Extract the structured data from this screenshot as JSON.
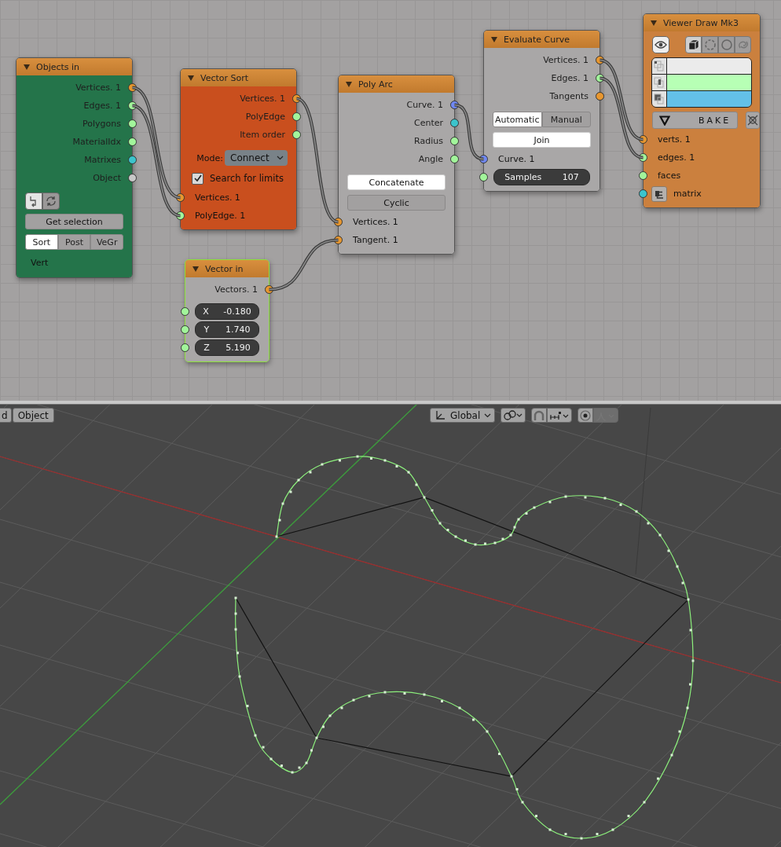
{
  "node_editor": {
    "nodes": [
      {
        "title": "Objects in",
        "color": "#24744a",
        "selected": false,
        "rows": [
          {
            "kind": "output",
            "label": "Vertices. 1",
            "color": "#e8972f"
          },
          {
            "kind": "output",
            "label": "Edges. 1",
            "color": "#a2f59b"
          },
          {
            "kind": "output",
            "label": "Polygons",
            "color": "#a2f59b"
          },
          {
            "kind": "output",
            "label": "MaterialIdx",
            "color": "#a2f59b"
          },
          {
            "kind": "output",
            "label": "Matrixes",
            "color": "#3cc4cc"
          },
          {
            "kind": "output",
            "label": "Object",
            "color": "#c8c8c8"
          },
          {
            "kind": "icon_toggle",
            "options": [
              {
                "selected": true
              },
              {
                "selected": false
              }
            ]
          },
          {
            "kind": "button",
            "label": "Get selection",
            "on": false
          },
          {
            "kind": "segmented",
            "options": [
              {
                "label": "Sort",
                "selected": true
              },
              {
                "label": "Post",
                "selected": false
              },
              {
                "label": "VeGr",
                "selected": false
              }
            ]
          },
          {
            "kind": "text",
            "label": "Vert"
          }
        ]
      },
      {
        "title": "Vector Sort",
        "color": "#c94f1e",
        "selected": false,
        "rows": [
          {
            "kind": "output",
            "label": "Vertices. 1",
            "color": "#e8972f"
          },
          {
            "kind": "output",
            "label": "PolyEdge",
            "color": "#a2f59b"
          },
          {
            "kind": "output",
            "label": "Item order",
            "color": "#a2f59b"
          },
          {
            "kind": "enum",
            "label": "Mode:",
            "value": "Connect"
          },
          {
            "kind": "checkbox",
            "label": "Search for limits",
            "checked": true
          },
          {
            "kind": "input",
            "label": "Vertices. 1",
            "color": "#e8972f"
          },
          {
            "kind": "input",
            "label": "PolyEdge. 1",
            "color": "#a2f59b"
          }
        ]
      },
      {
        "title": "Poly Arc",
        "color": "#a9a7a7",
        "selected": false,
        "rows": [
          {
            "kind": "output",
            "label": "Curve. 1",
            "color": "#7088f2"
          },
          {
            "kind": "output",
            "label": "Center",
            "color": "#3cc4cc"
          },
          {
            "kind": "output",
            "label": "Radius",
            "color": "#a2f59b"
          },
          {
            "kind": "output",
            "label": "Angle",
            "color": "#a2f59b"
          },
          {
            "kind": "button",
            "label": "Concatenate",
            "on": true
          },
          {
            "kind": "button",
            "label": "Cyclic",
            "on": false
          },
          {
            "kind": "input",
            "label": "Vertices. 1",
            "color": "#e8972f"
          },
          {
            "kind": "input",
            "label": "Tangent. 1",
            "color": "#e8972f"
          }
        ]
      },
      {
        "title": "Evaluate Curve",
        "color": "#a9a7a7",
        "selected": false,
        "rows": [
          {
            "kind": "output",
            "label": "Vertices. 1",
            "color": "#e8972f"
          },
          {
            "kind": "output",
            "label": "Edges. 1",
            "color": "#a2f59b"
          },
          {
            "kind": "output",
            "label": "Tangents",
            "color": "#e8972f"
          },
          {
            "kind": "segmented",
            "options": [
              {
                "label": "Automatic",
                "selected": true
              },
              {
                "label": "Manual",
                "selected": false
              }
            ]
          },
          {
            "kind": "button",
            "label": "Join",
            "on": true
          },
          {
            "kind": "input",
            "label": "Curve. 1",
            "color": "#7088f2"
          },
          {
            "kind": "number",
            "label": "Samples",
            "value": "107",
            "color": "#a2f59b"
          }
        ]
      },
      {
        "title": "Viewer Draw Mk3",
        "color": "#cb803e",
        "selected": false,
        "rows": [
          {
            "kind": "display_modes",
            "eye_on": true,
            "options": [
              {
                "selected": true
              },
              {
                "selected": false
              },
              {
                "selected": false
              },
              {
                "selected": false
              }
            ]
          },
          {
            "kind": "colors",
            "items": [
              {
                "color": "#ebebeb"
              },
              {
                "color": "#b7ffb5"
              },
              {
                "color": "#63c0e8"
              }
            ]
          },
          {
            "kind": "bake",
            "label": "BAKE"
          },
          {
            "kind": "input",
            "label": "verts. 1",
            "color": "#e8972f"
          },
          {
            "kind": "input",
            "label": "edges. 1",
            "color": "#a2f59b"
          },
          {
            "kind": "input",
            "label": "faces",
            "color": "#a2f59b"
          },
          {
            "kind": "input",
            "label": "matrix",
            "color": "#3cc4cc",
            "icon": true
          }
        ]
      },
      {
        "title": "Vector in",
        "color": "#a9a7a7",
        "selected": true,
        "rows": [
          {
            "kind": "output",
            "label": "Vectors. 1",
            "color": "#e8972f"
          },
          {
            "kind": "number",
            "label": "X",
            "value": "-0.180",
            "color": "#a2f59b"
          },
          {
            "kind": "number",
            "label": "Y",
            "value": "1.740",
            "color": "#a2f59b"
          },
          {
            "kind": "number",
            "label": "Z",
            "value": "5.190",
            "color": "#a2f59b"
          }
        ]
      }
    ]
  },
  "viewport": {
    "header": {
      "mode_buttons": [
        "d",
        "Object"
      ],
      "orientation": "Global"
    }
  }
}
